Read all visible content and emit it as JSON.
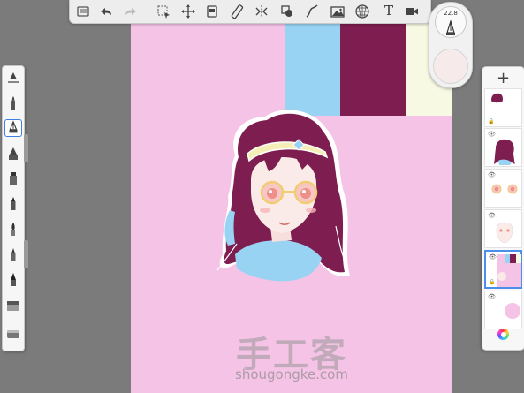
{
  "app": {
    "brush": {
      "size": "22.8"
    },
    "toolbar": {
      "items": [
        {
          "name": "menu-icon"
        },
        {
          "name": "undo-icon"
        },
        {
          "name": "redo-icon"
        },
        {
          "name": "selection-icon"
        },
        {
          "name": "transform-icon"
        },
        {
          "name": "layers-copy-icon"
        },
        {
          "name": "ruler-icon"
        },
        {
          "name": "symmetry-icon"
        },
        {
          "name": "fill-icon"
        },
        {
          "name": "stroke-icon"
        },
        {
          "name": "image-icon"
        },
        {
          "name": "perspective-icon"
        },
        {
          "name": "text-icon"
        },
        {
          "name": "video-icon"
        }
      ],
      "text_tool_label": "T"
    },
    "layers": {
      "add_label": "+"
    },
    "watermark": {
      "brand": "手工客",
      "url": "shougongke.com"
    }
  },
  "colors": {
    "canvas_pink": "#f5c3e6",
    "swatch_blue": "#99d3f4",
    "swatch_maroon": "#7e1d4f",
    "swatch_cream": "#f7f9e3",
    "selection_blue": "#3f7fe0"
  }
}
